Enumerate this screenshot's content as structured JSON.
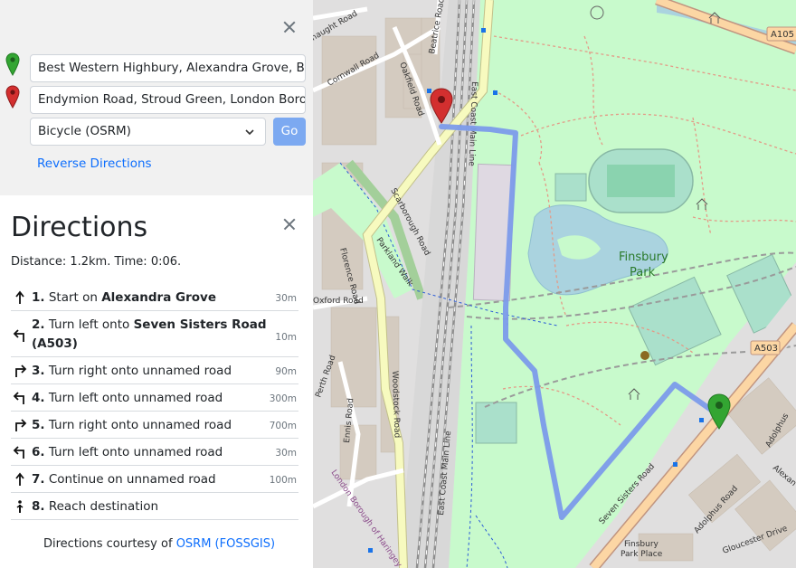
{
  "panel": {
    "from_value": "Best Western Highbury, Alexandra Grove, Brownswood",
    "to_value": "Endymion Road, Stroud Green, London Borough of Haringey",
    "engine": "Bicycle (OSRM)",
    "go_label": "Go",
    "reverse_label": "Reverse Directions"
  },
  "directions": {
    "title": "Directions",
    "summary": "Distance: 1.2km. Time: 0:06.",
    "steps": [
      {
        "num": "1.",
        "text": "Start on ",
        "bold": "Alexandra Grove",
        "dist": "30m",
        "icon": "straight-arrow-icon"
      },
      {
        "num": "2.",
        "text": "Turn left onto ",
        "bold": "Seven Sisters Road (A503)",
        "dist": "10m",
        "icon": "turn-left-icon"
      },
      {
        "num": "3.",
        "text": "Turn right onto unnamed road",
        "bold": "",
        "dist": "90m",
        "icon": "turn-right-icon"
      },
      {
        "num": "4.",
        "text": "Turn left onto unnamed road",
        "bold": "",
        "dist": "300m",
        "icon": "turn-left-icon"
      },
      {
        "num": "5.",
        "text": "Turn right onto unnamed road",
        "bold": "",
        "dist": "700m",
        "icon": "turn-right-icon"
      },
      {
        "num": "6.",
        "text": "Turn left onto unnamed road",
        "bold": "",
        "dist": "30m",
        "icon": "turn-left-icon"
      },
      {
        "num": "7.",
        "text": "Continue on unnamed road",
        "bold": "",
        "dist": "100m",
        "icon": "straight-arrow-icon"
      },
      {
        "num": "8.",
        "text": "Reach destination",
        "bold": "",
        "dist": "",
        "icon": "destination-icon"
      }
    ],
    "credit_prefix": "Directions courtesy of ",
    "credit_link": "OSRM (FOSSGIS)"
  },
  "map": {
    "labels": {
      "finsbury": "Finsbury",
      "park": "Park",
      "a503_a": "A503",
      "a105": "A105",
      "oakfield": "Oakfield Road",
      "beatrice": "Beatrice Road",
      "cornwall": "Cornwall Road",
      "naught": "naught Road",
      "scarborough": "Scarborough Road",
      "parkland": "Parkland Walk",
      "florence": "Florence Road",
      "oxford": "Oxford Road",
      "perth": "Perth Road",
      "ennis": "Ennis Road",
      "woodstock": "Woodstock Road",
      "eastcoast": "East Coast Main Line",
      "eastcoast2": "East Coast Main Line",
      "seven": "Seven Sisters Road",
      "adolphus": "Adolphus Road",
      "adolphus2": "Adolphus",
      "alexan": "Alexan",
      "gloucester": "Gloucester Drive",
      "fpp1": "Finsbury",
      "fpp2": "Park Place",
      "haringey": "London Borough of Haringey"
    },
    "colors": {
      "park_green": "#c8facc",
      "route": "#7c9bea",
      "rail": "#8e8e8e",
      "water": "#aad3df",
      "residential": "#e0dfdf",
      "primary_road": "#fcd6a4",
      "secondary_road": "#f7fabf",
      "start_marker": "#33a532",
      "end_marker": "#d32f2f"
    }
  }
}
